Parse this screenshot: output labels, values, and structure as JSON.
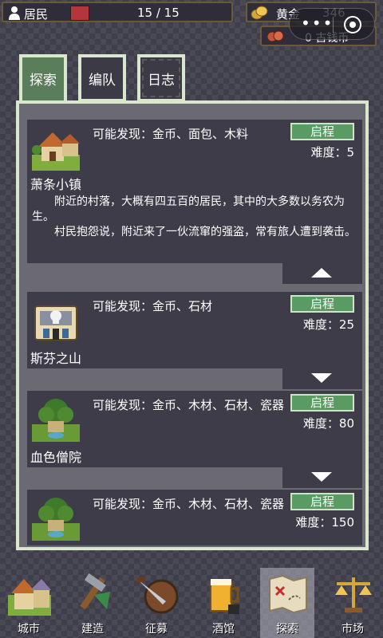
{
  "top": {
    "resident_label": "居民",
    "resident_count": "15 / 15",
    "gold_label": "黄金",
    "gold_value": "346",
    "coin_value": "0 古钱币"
  },
  "tabs": [
    {
      "label": "探索",
      "active": true
    },
    {
      "label": "编队",
      "active": false
    },
    {
      "label": "日志",
      "active": false
    }
  ],
  "locations": [
    {
      "finds": "可能发现：金币、面包、木料",
      "go_label": "启程",
      "difficulty": "难度：5",
      "name": "萧条小镇",
      "desc1": "附近的村落，大概有四五百的居民，其中的大多数以务农为生。",
      "desc2": "村民抱怨说，附近来了一伙流窜的强盗，常有旅人遭到袭击。"
    },
    {
      "finds": "可能发现：金币、石材",
      "go_label": "启程",
      "difficulty": "难度：25",
      "name": "斯芬之山"
    },
    {
      "finds": "可能发现：金币、木材、石材、瓷器",
      "go_label": "启程",
      "difficulty": "难度：80",
      "name": "血色僧院"
    },
    {
      "finds": "可能发现：金币、木材、石材、瓷器",
      "go_label": "启程",
      "difficulty": "难度：150"
    }
  ],
  "nav": [
    {
      "label": "城市",
      "icon": "city-icon"
    },
    {
      "label": "建造",
      "icon": "build-icon"
    },
    {
      "label": "征募",
      "icon": "recruit-icon"
    },
    {
      "label": "酒馆",
      "icon": "tavern-icon"
    },
    {
      "label": "探索",
      "icon": "explore-map-icon",
      "active": true
    },
    {
      "label": "市场",
      "icon": "market-scale-icon"
    }
  ]
}
